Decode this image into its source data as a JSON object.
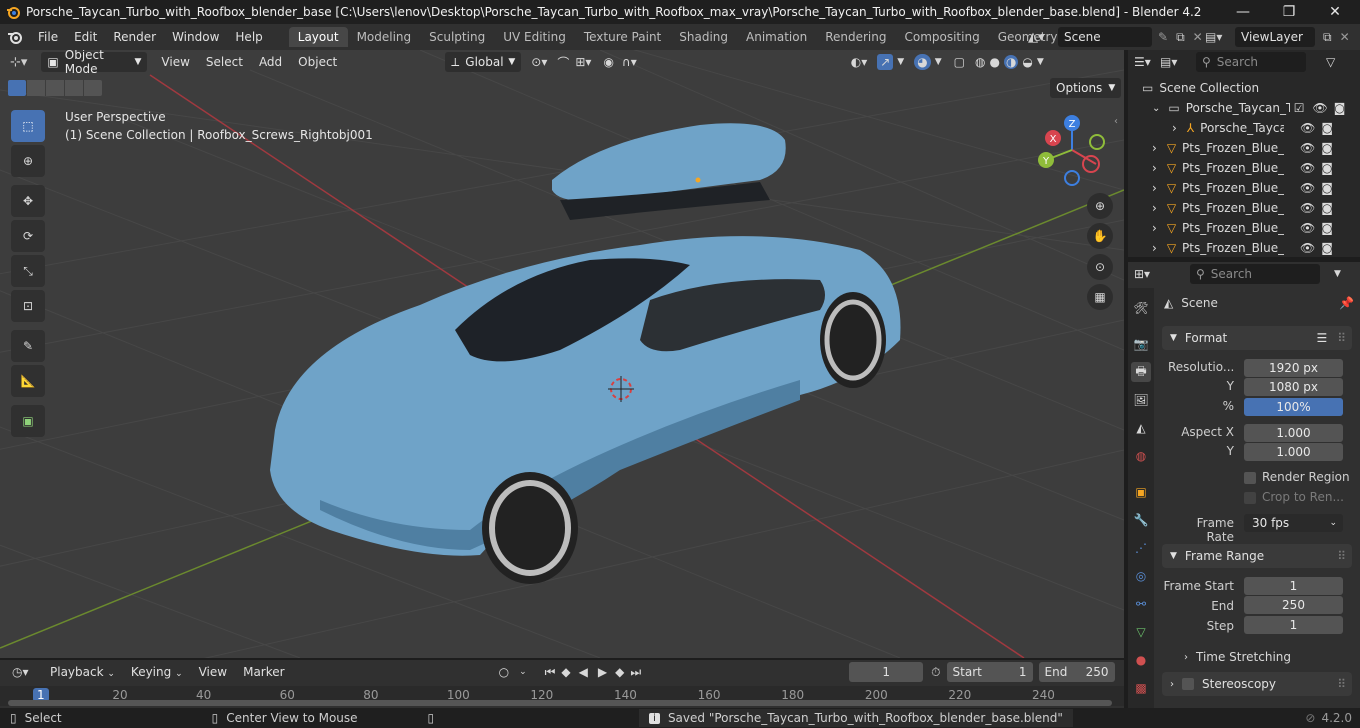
{
  "window": {
    "title": "Porsche_Taycan_Turbo_with_Roofbox_blender_base [C:\\Users\\lenov\\Desktop\\Porsche_Taycan_Turbo_with_Roofbox_max_vray\\Porsche_Taycan_Turbo_with_Roofbox_blender_base.blend] - Blender 4.2",
    "minimize": "—",
    "maximize": "❐",
    "close": "✕"
  },
  "menubar": {
    "items": [
      "File",
      "Edit",
      "Render",
      "Window",
      "Help"
    ],
    "workspaces": [
      "Layout",
      "Modeling",
      "Sculpting",
      "UV Editing",
      "Texture Paint",
      "Shading",
      "Animation",
      "Rendering",
      "Compositing",
      "Geometry Nod"
    ],
    "active_workspace": "Layout",
    "scene": "Scene",
    "view_layer": "ViewLayer"
  },
  "viewport": {
    "mode": "Object Mode",
    "menus": [
      "View",
      "Select",
      "Add",
      "Object"
    ],
    "orientation": "Global",
    "options": "Options",
    "perspective": "User Perspective",
    "context": "(1) Scene Collection | Roofbox_Screws_Rightobj001",
    "gizmo": {
      "x": "X",
      "y": "Y",
      "z": "Z"
    }
  },
  "outliner": {
    "search_placeholder": "Search",
    "root": "Scene Collection",
    "collection": "Porsche_Taycan_Tu",
    "items": [
      {
        "name": "Porsche_Taycan",
        "type": "armature"
      },
      {
        "name": "Pts_Frozen_Blue_B",
        "type": "mesh"
      },
      {
        "name": "Pts_Frozen_Blue_B",
        "type": "mesh"
      },
      {
        "name": "Pts_Frozen_Blue_B",
        "type": "mesh"
      },
      {
        "name": "Pts_Frozen_Blue_D",
        "type": "mesh"
      },
      {
        "name": "Pts_Frozen_Blue_D",
        "type": "mesh"
      },
      {
        "name": "Pts_Frozen_Blue_D",
        "type": "mesh"
      }
    ]
  },
  "properties": {
    "search_placeholder": "Search",
    "context": "Scene",
    "format_panel": "Format",
    "resolution_label": "Resolutio...",
    "resolution_x": "1920 px",
    "y_label": "Y",
    "resolution_y": "1080 px",
    "percent_label": "%",
    "percent": "100%",
    "aspect_x_label": "Aspect X",
    "aspect_x": "1.000",
    "aspect_y_label": "Y",
    "aspect_y": "1.000",
    "render_region": "Render Region",
    "crop": "Crop to Ren...",
    "frame_rate_label": "Frame Rate",
    "frame_rate": "30 fps",
    "frame_range_panel": "Frame Range",
    "frame_start_label": "Frame Start",
    "frame_start": "1",
    "end_label": "End",
    "end": "250",
    "step_label": "Step",
    "step": "1",
    "time_stretching": "Time Stretching",
    "stereoscopy": "Stereoscopy"
  },
  "timeline": {
    "menus": [
      "Playback",
      "Keying",
      "View",
      "Marker"
    ],
    "current_frame": "1",
    "start_label": "Start",
    "start": "1",
    "end_label": "End",
    "end": "250",
    "ruler": [
      "1",
      "20",
      "40",
      "60",
      "80",
      "100",
      "120",
      "140",
      "160",
      "180",
      "200",
      "220",
      "240"
    ]
  },
  "statusbar": {
    "select": "Select",
    "center_view": "Center View to Mouse",
    "message": "Saved \"Porsche_Taycan_Turbo_with_Roofbox_blender_base.blend\"",
    "version": "4.2.0"
  },
  "colors": {
    "accent": "#4772b3",
    "car_body": "#6fa3c8",
    "axis_x": "#d8454f",
    "axis_y": "#8fbc3a",
    "axis_z": "#3d7fe0"
  }
}
